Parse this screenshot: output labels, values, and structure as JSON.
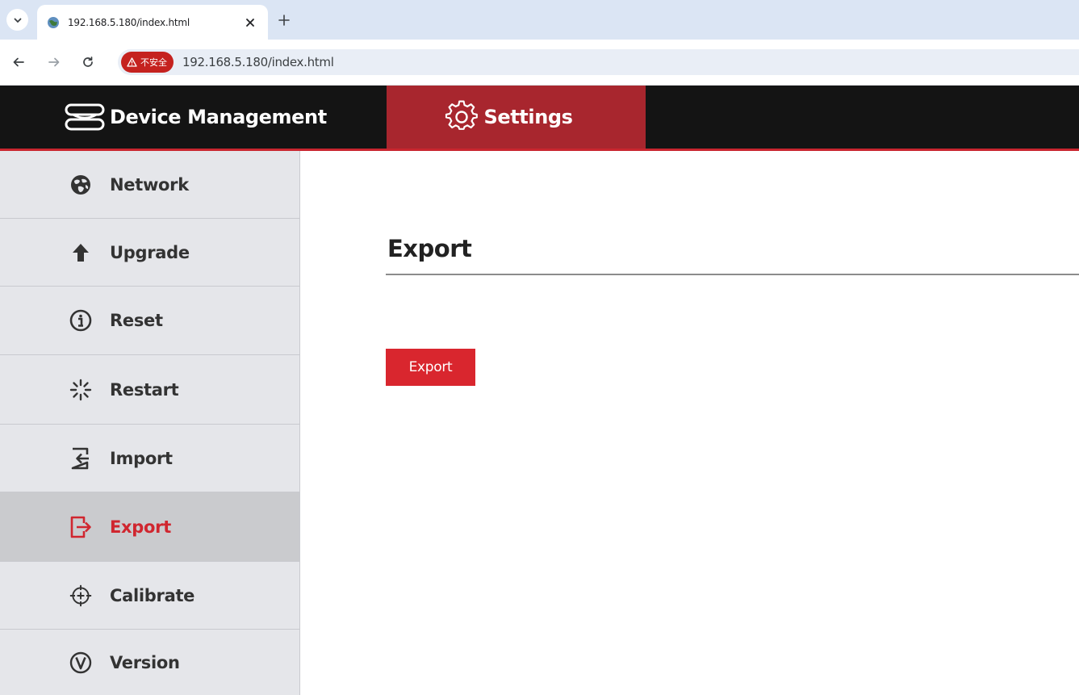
{
  "browser": {
    "tab": {
      "title": "192.168.5.180/index.html"
    },
    "security_chip": {
      "label": "不安全"
    },
    "url": "192.168.5.180/index.html"
  },
  "header": {
    "brand": {
      "label": "Device Management",
      "icon": "server-icon"
    },
    "active_tab": {
      "label": "Settings",
      "icon": "gear-icon"
    }
  },
  "sidebar": {
    "items": [
      {
        "label": "Network",
        "icon": "globe-icon",
        "active": false
      },
      {
        "label": "Upgrade",
        "icon": "arrow-up-icon",
        "active": false
      },
      {
        "label": "Reset",
        "icon": "info-circle-icon",
        "active": false
      },
      {
        "label": "Restart",
        "icon": "spinner-icon",
        "active": false
      },
      {
        "label": "Import",
        "icon": "import-icon",
        "active": false
      },
      {
        "label": "Export",
        "icon": "export-icon",
        "active": true
      },
      {
        "label": "Calibrate",
        "icon": "crosshair-icon",
        "active": false
      },
      {
        "label": "Version",
        "icon": "version-circle-icon",
        "active": false
      }
    ]
  },
  "main": {
    "title": "Export",
    "button_label": "Export"
  },
  "colors": {
    "accent": "#d9262e",
    "header_bg": "#141414",
    "settings_tab_bg": "#a8262e",
    "sidebar_bg": "#e5e6ea",
    "sidebar_active_bg": "#cacbce"
  }
}
